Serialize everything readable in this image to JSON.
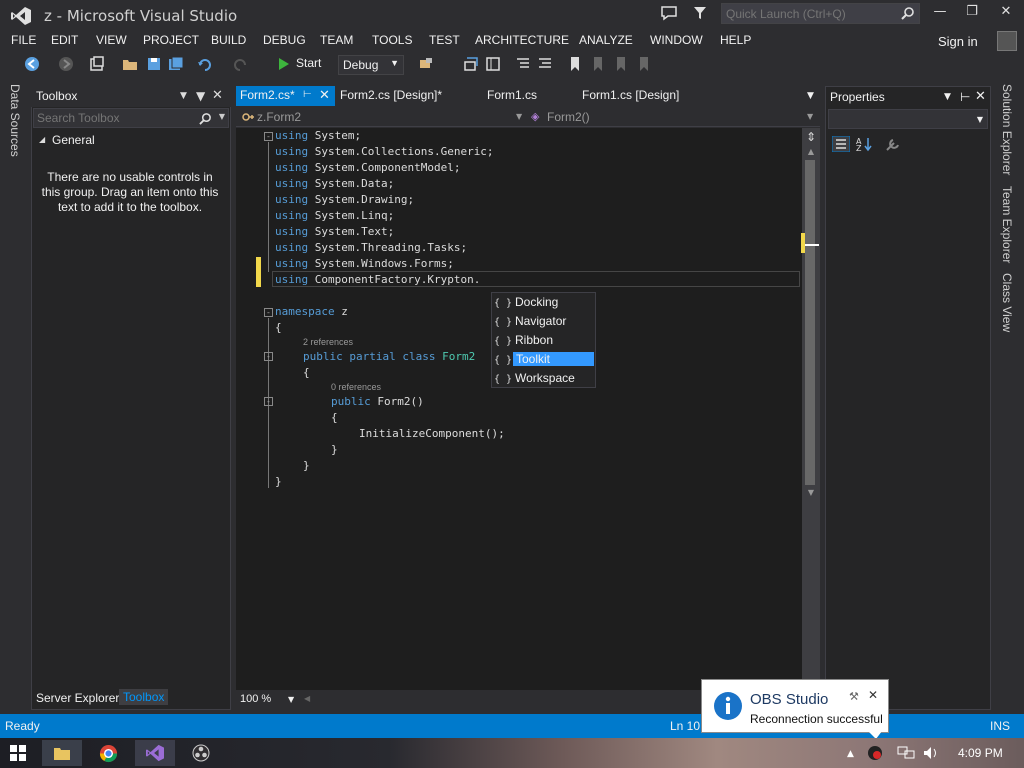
{
  "window": {
    "title": "z - Microsoft Visual Studio",
    "quick_launch_placeholder": "Quick Launch (Ctrl+Q)"
  },
  "menu": [
    "FILE",
    "EDIT",
    "VIEW",
    "PROJECT",
    "BUILD",
    "DEBUG",
    "TEAM",
    "TOOLS",
    "TEST",
    "ARCHITECTURE",
    "ANALYZE",
    "WINDOW",
    "HELP"
  ],
  "signin": "Sign in",
  "toolbar": {
    "start_label": "Start",
    "config": "Debug"
  },
  "side_tabs": {
    "left": "Data Sources",
    "right": [
      "Solution Explorer",
      "Team Explorer",
      "Class View"
    ]
  },
  "toolbox": {
    "title": "Toolbox",
    "search_placeholder": "Search Toolbox",
    "group": "General",
    "empty_text": "There are no usable controls in this group. Drag an item onto this text to add it to the toolbox.",
    "bottom_tabs": [
      "Server Explorer",
      "Toolbox"
    ]
  },
  "editor": {
    "tabs": [
      "Form2.cs*",
      "Form2.cs [Design]*",
      "Form1.cs",
      "Form1.cs [Design]"
    ],
    "nav_left": "z.Form2",
    "nav_right": "Form2()",
    "zoom": "100 %",
    "code_lines": [
      {
        "kw": "using",
        "rest": " System;"
      },
      {
        "kw": "using",
        "rest": " System.Collections.Generic;"
      },
      {
        "kw": "using",
        "rest": " System.ComponentModel;"
      },
      {
        "kw": "using",
        "rest": " System.Data;"
      },
      {
        "kw": "using",
        "rest": " System.Drawing;"
      },
      {
        "kw": "using",
        "rest": " System.Linq;"
      },
      {
        "kw": "using",
        "rest": " System.Text;"
      },
      {
        "kw": "using",
        "rest": " System.Threading.Tasks;"
      },
      {
        "kw": "using",
        "rest": " System.Windows.Forms;"
      },
      {
        "kw": "using",
        "rest": " ComponentFactory.Krypton."
      }
    ],
    "namespace_kw": "namespace",
    "namespace_name": " z",
    "open_brace": "{",
    "close_brace": "}",
    "refs_class": "2 references",
    "class_kw": "public partial class",
    "class_name": " Form2",
    "refs_ctor": "0 references",
    "ctor_kw": "public",
    "ctor_name": " Form2()",
    "init_call": "InitializeComponent();"
  },
  "completion": {
    "items": [
      "Docking",
      "Navigator",
      "Ribbon",
      "Toolkit",
      "Workspace"
    ],
    "selected_index": 3,
    "icon_glyph": "{ }"
  },
  "properties": {
    "title": "Properties"
  },
  "status": {
    "ready": "Ready",
    "line": "Ln 10",
    "mode": "INS"
  },
  "toast": {
    "title": "OBS Studio",
    "message": "Reconnection successful"
  },
  "taskbar": {
    "clock": "4:09 PM"
  },
  "colors": {
    "accent": "#007acc",
    "selection": "#3399ff",
    "keyword": "#569cd6",
    "type": "#4ec9b0"
  }
}
